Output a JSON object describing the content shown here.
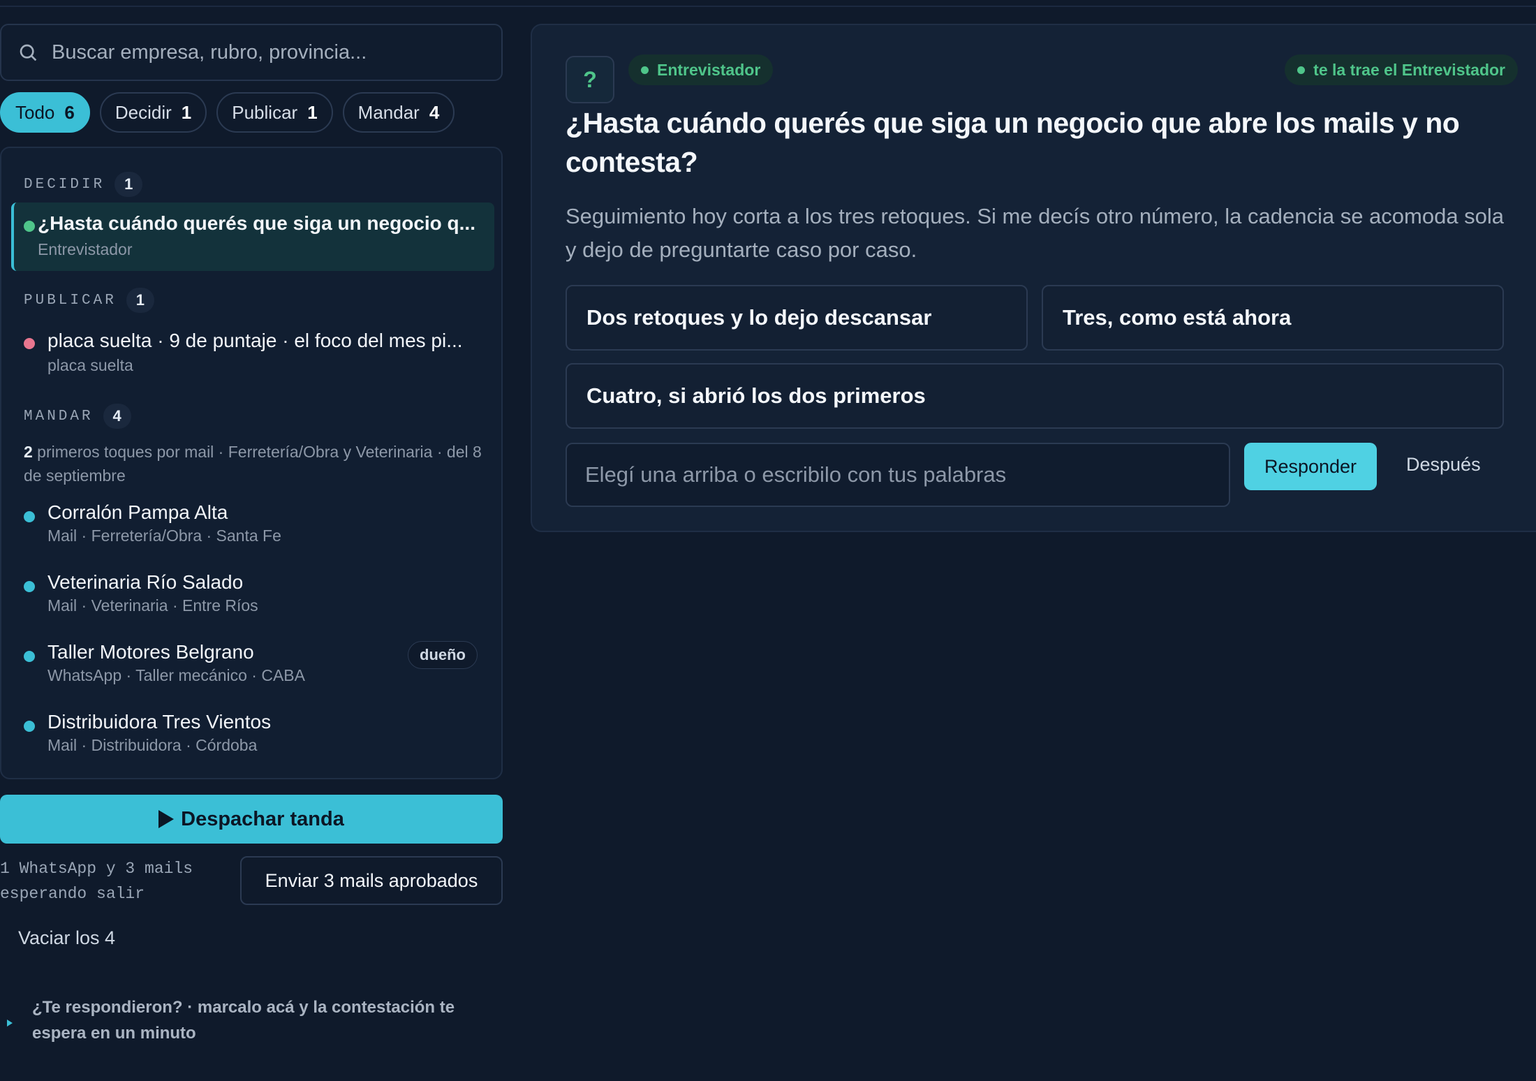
{
  "search": {
    "placeholder": "Buscar empresa, rubro, provincia..."
  },
  "filters": [
    {
      "label": "Todo",
      "count": "6",
      "active": true
    },
    {
      "label": "Decidir",
      "count": "1",
      "active": false
    },
    {
      "label": "Publicar",
      "count": "1",
      "active": false
    },
    {
      "label": "Mandar",
      "count": "4",
      "active": false
    }
  ],
  "queue": {
    "decidir": {
      "heading": "DECIDIR",
      "count": "1",
      "item": {
        "title": "¿Hasta cuándo querés que siga un negocio q...",
        "subtitle": "Entrevistador"
      }
    },
    "publicar": {
      "heading": "PUBLICAR",
      "count": "1",
      "item": {
        "title": "placa suelta · 9 de puntaje · el foco del mes pi...",
        "subtitle": "placa suelta"
      }
    },
    "mandar": {
      "heading": "MANDAR",
      "count": "4",
      "info_count": "2",
      "info_text": " primeros toques por mail · Ferretería/Obra y Veterinaria · del 8 de septiembre",
      "items": [
        {
          "title": "Corralón Pampa Alta",
          "subtitle": "Mail · Ferretería/Obra · Santa Fe",
          "tag": ""
        },
        {
          "title": "Veterinaria Río Salado",
          "subtitle": "Mail · Veterinaria · Entre Ríos",
          "tag": ""
        },
        {
          "title": "Taller Motores Belgrano",
          "subtitle": "WhatsApp · Taller mecánico · CABA",
          "tag": "dueño"
        },
        {
          "title": "Distribuidora Tres Vientos",
          "subtitle": "Mail · Distribuidora · Córdoba",
          "tag": ""
        }
      ]
    }
  },
  "actions": {
    "dispatch": "Despachar tanda",
    "waiting": "1 WhatsApp y 3 mails esperando salir",
    "send_approved": "Enviar 3 mails aprobados",
    "empty": "Vaciar los 4",
    "replied": "¿Te respondieron? · marcalo acá y la contestación te espera en un minuto"
  },
  "question": {
    "icon": "?",
    "source_pill": "Entrevistador",
    "right_pill": "te la trae el Entrevistador",
    "title": "¿Hasta cuándo querés que siga un negocio que abre los mails y no contesta?",
    "description": "Seguimiento hoy corta a los tres retoques. Si me decís otro número, la cadencia se acomoda sola y dejo de preguntarte caso por caso.",
    "options": [
      "Dos retoques y lo dejo descansar",
      "Tres, como está ahora",
      "Cuatro, si abrió los dos primeros"
    ],
    "answer_placeholder": "Elegí una arriba o escribilo con tus palabras",
    "respond": "Responder",
    "later": "Después"
  },
  "colors": {
    "accent": "#3bbfd6",
    "green": "#4fc58a",
    "pink": "#e8768f",
    "cyan_dot": "#3bbfd6"
  }
}
